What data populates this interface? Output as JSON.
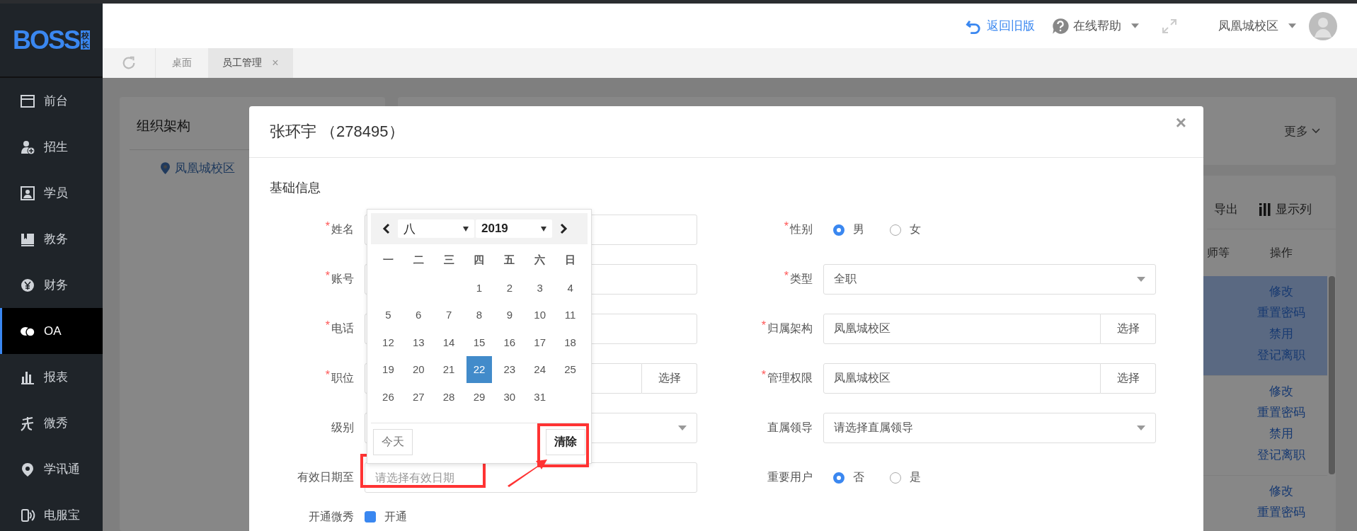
{
  "sidebar": {
    "logo": {
      "text": "BOSS",
      "badge": "校长"
    },
    "items": [
      {
        "label": "前台",
        "selected": false
      },
      {
        "label": "招生",
        "selected": false
      },
      {
        "label": "学员",
        "selected": false
      },
      {
        "label": "教务",
        "selected": false
      },
      {
        "label": "财务",
        "selected": false
      },
      {
        "label": "OA",
        "selected": true
      },
      {
        "label": "报表",
        "selected": false
      },
      {
        "label": "微秀",
        "selected": false
      },
      {
        "label": "学讯通",
        "selected": false
      },
      {
        "label": "电服宝",
        "selected": false
      }
    ]
  },
  "header": {
    "back_link": "返回旧版",
    "help": "在线帮助",
    "campus": "凤凰城校区"
  },
  "tabs": [
    {
      "label": "桌面",
      "selected": false
    },
    {
      "label": "员工管理",
      "selected": true,
      "close": "×"
    }
  ],
  "org_panel": {
    "title": "组织架构",
    "tree_item": "凤凰城校区"
  },
  "list_panel": {
    "more": "更多",
    "export": "导出",
    "columns_button": "显示列",
    "table": {
      "columns": [
        "师等",
        "操作"
      ],
      "rows": [
        {
          "selected": true,
          "actions": [
            "修改",
            "重置密码",
            "禁用",
            "登记离职"
          ]
        },
        {
          "selected": false,
          "actions": [
            "修改",
            "重置密码",
            "禁用",
            "登记离职"
          ]
        },
        {
          "selected": false,
          "actions": [
            "修改",
            "重置密码"
          ]
        }
      ]
    }
  },
  "modal": {
    "title": "张环宇 （278495）",
    "close": "×",
    "section": "基础信息",
    "left_fields": [
      {
        "label": "姓名",
        "marker": "*",
        "kind": "input"
      },
      {
        "label": "账号",
        "marker": "*",
        "kind": "input"
      },
      {
        "label": "电话",
        "marker": "*",
        "kind": "input"
      },
      {
        "label": "职位",
        "marker": "*",
        "kind": "input_button",
        "button": "选择"
      },
      {
        "label": "级别",
        "kind": "select"
      },
      {
        "label": "有效日期至",
        "kind": "input",
        "placeholder": "请选择有效日期",
        "highlighted": true
      },
      {
        "label": "开通微秀",
        "kind": "checkbox",
        "option": "开通",
        "checked": true
      }
    ],
    "right_fields": [
      {
        "label": "性别",
        "marker": "*",
        "kind": "radio",
        "options": [
          {
            "label": "男",
            "selected": true
          },
          {
            "label": "女",
            "selected": false
          }
        ]
      },
      {
        "label": "类型",
        "marker": "*",
        "kind": "select",
        "value": "全职"
      },
      {
        "label": "归属架构",
        "marker": "*",
        "kind": "input_button",
        "value": "凤凰城校区",
        "button": "选择"
      },
      {
        "label": "管理权限",
        "marker": "*",
        "kind": "input_button",
        "value": "凤凰城校区",
        "button": "选择"
      },
      {
        "label": "直属领导",
        "kind": "select",
        "value": "请选择直属领导"
      },
      {
        "label": "重要用户",
        "kind": "radio",
        "options": [
          {
            "label": "否",
            "selected": true
          },
          {
            "label": "是",
            "selected": false
          }
        ]
      }
    ]
  },
  "datepicker": {
    "month": "八",
    "year": "2019",
    "weekdays": [
      "一",
      "二",
      "三",
      "四",
      "五",
      "六",
      "日"
    ],
    "weeks": [
      {
        "kind": "first",
        "days": [
          {
            "label": "1",
            "selected": false
          },
          {
            "label": "2",
            "selected": false
          },
          {
            "label": "3",
            "selected": false
          },
          {
            "label": "4",
            "selected": false
          }
        ]
      },
      {
        "kind": "full",
        "days": [
          {
            "label": "5",
            "selected": false
          },
          {
            "label": "6",
            "selected": false
          },
          {
            "label": "7",
            "selected": false
          },
          {
            "label": "8",
            "selected": false
          },
          {
            "label": "9",
            "selected": false
          },
          {
            "label": "10",
            "selected": false
          },
          {
            "label": "11",
            "selected": false
          }
        ]
      },
      {
        "kind": "full",
        "days": [
          {
            "label": "12",
            "selected": false
          },
          {
            "label": "13",
            "selected": false
          },
          {
            "label": "14",
            "selected": false
          },
          {
            "label": "15",
            "selected": false
          },
          {
            "label": "16",
            "selected": false
          },
          {
            "label": "17",
            "selected": false
          },
          {
            "label": "18",
            "selected": false
          }
        ]
      },
      {
        "kind": "full",
        "days": [
          {
            "label": "19",
            "selected": false
          },
          {
            "label": "20",
            "selected": false
          },
          {
            "label": "21",
            "selected": false
          },
          {
            "label": "22",
            "selected": true
          },
          {
            "label": "23",
            "selected": false
          },
          {
            "label": "24",
            "selected": false
          },
          {
            "label": "25",
            "selected": false
          }
        ]
      },
      {
        "kind": "last",
        "days": [
          {
            "label": "26",
            "selected": false
          },
          {
            "label": "27",
            "selected": false
          },
          {
            "label": "28",
            "selected": false
          },
          {
            "label": "29",
            "selected": false
          },
          {
            "label": "30",
            "selected": false
          },
          {
            "label": "31",
            "selected": false
          }
        ]
      }
    ],
    "today": "今天",
    "clear": {
      "label": "清除",
      "highlighted": true
    }
  }
}
